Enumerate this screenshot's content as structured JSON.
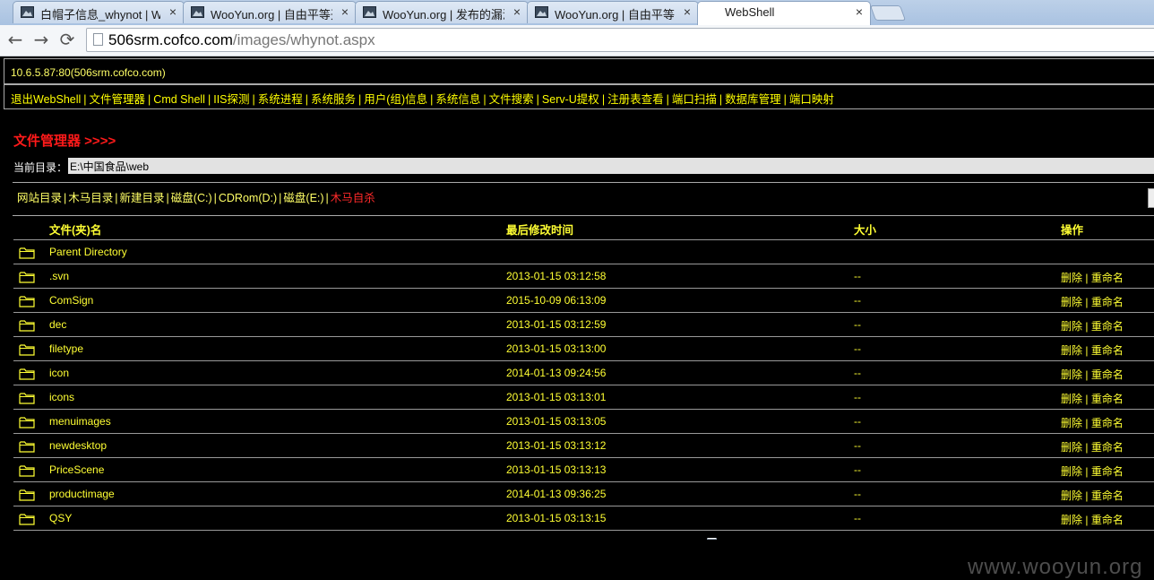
{
  "browser": {
    "tabs": [
      {
        "title": "白帽子信息_whynot | Wo",
        "icon": "wooyun-favicon",
        "close": "×"
      },
      {
        "title": "WooYun.org | 自由平等开",
        "icon": "wooyun-favicon",
        "close": "×"
      },
      {
        "title": "WooYun.org | 发布的漏洞",
        "icon": "wooyun-favicon",
        "close": "×"
      },
      {
        "title": "WooYun.org | 自由平等开",
        "icon": "wooyun-favicon",
        "close": "×"
      },
      {
        "title": "WebShell",
        "icon": "page-icon",
        "close": "×"
      }
    ],
    "nav": {
      "back": "←",
      "forward": "→",
      "reload": "⟳"
    },
    "url_host": "506srm.cofco.com",
    "url_path": "/images/whynot.aspx"
  },
  "header": {
    "host": "10.6.5.87:80(506srm.cofco.com)"
  },
  "menu": [
    "退出WebShell",
    "文件管理器",
    "Cmd Shell",
    "IIS探测",
    "系统进程",
    "系统服务",
    "用户(组)信息",
    "系统信息",
    "文件搜索",
    "Serv-U提权",
    "注册表查看",
    "端口扫描",
    "数据库管理",
    "端口映射"
  ],
  "file_manager": {
    "title": "文件管理器 >>>>",
    "current_dir_label": "当前目录：",
    "current_dir": "E:\\中国食品\\web",
    "quick_links": [
      "网站目录",
      "木马目录",
      "新建目录",
      "磁盘(C:)",
      "CDRom(D:)",
      "磁盘(E:)"
    ],
    "danger_link": "木马自杀",
    "columns": {
      "name": "文件(夹)名",
      "modified": "最后修改时间",
      "size": "大小",
      "ops": "操作"
    },
    "rows": [
      {
        "name": "Parent Directory",
        "modified": "",
        "size": "",
        "delete": "",
        "rename": ""
      },
      {
        "name": ".svn",
        "modified": "2013-01-15 03:12:58",
        "size": "--",
        "delete": "删除",
        "rename": "重命名"
      },
      {
        "name": "ComSign",
        "modified": "2015-10-09 06:13:09",
        "size": "--",
        "delete": "删除",
        "rename": "重命名"
      },
      {
        "name": "dec",
        "modified": "2013-01-15 03:12:59",
        "size": "--",
        "delete": "删除",
        "rename": "重命名"
      },
      {
        "name": "filetype",
        "modified": "2013-01-15 03:13:00",
        "size": "--",
        "delete": "删除",
        "rename": "重命名"
      },
      {
        "name": "icon",
        "modified": "2014-01-13 09:24:56",
        "size": "--",
        "delete": "删除",
        "rename": "重命名"
      },
      {
        "name": "icons",
        "modified": "2013-01-15 03:13:01",
        "size": "--",
        "delete": "删除",
        "rename": "重命名"
      },
      {
        "name": "menuimages",
        "modified": "2013-01-15 03:13:05",
        "size": "--",
        "delete": "删除",
        "rename": "重命名"
      },
      {
        "name": "newdesktop",
        "modified": "2013-01-15 03:13:12",
        "size": "--",
        "delete": "删除",
        "rename": "重命名"
      },
      {
        "name": "PriceScene",
        "modified": "2013-01-15 03:13:13",
        "size": "--",
        "delete": "删除",
        "rename": "重命名"
      },
      {
        "name": "productimage",
        "modified": "2014-01-13 09:36:25",
        "size": "--",
        "delete": "删除",
        "rename": "重命名"
      },
      {
        "name": "QSY",
        "modified": "2013-01-15 03:13:15",
        "size": "--",
        "delete": "删除",
        "rename": "重命名"
      }
    ]
  },
  "watermark": "www.wooyun.org"
}
